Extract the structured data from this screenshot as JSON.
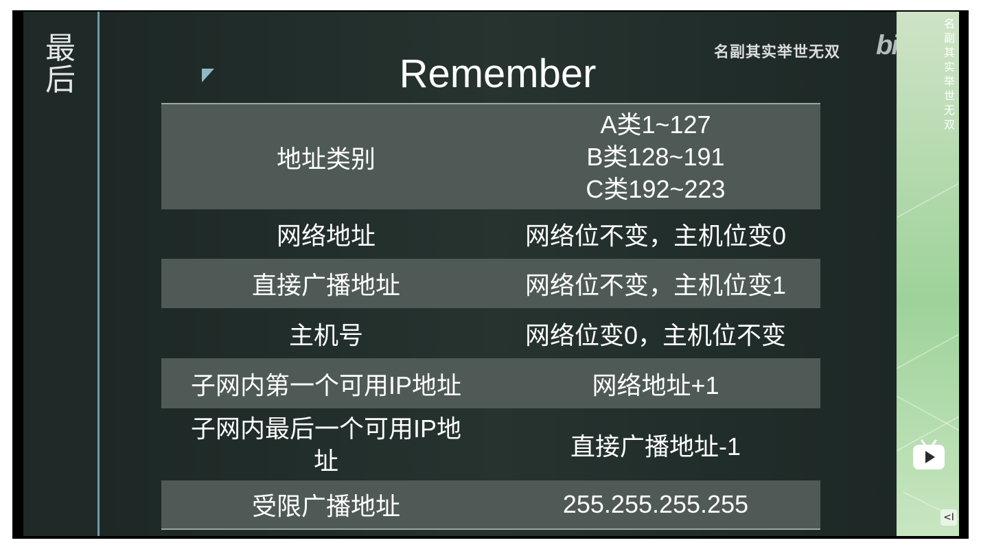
{
  "side_title": "最后",
  "heading": "Remember",
  "watermark": "名副其实举世无双",
  "logo": "bilibili",
  "side_vertical_text": "名副其实举世无双",
  "collapse_label": "<I",
  "rows": [
    {
      "label": "地址类别",
      "value_lines": [
        "A类1~127",
        "B类128~191",
        "C类192~223"
      ]
    },
    {
      "label": "网络地址",
      "value": "网络位不变，主机位变0"
    },
    {
      "label": "直接广播地址",
      "value": "网络位不变，主机位变1"
    },
    {
      "label": "主机号",
      "value": "网络位变0，主机位不变"
    },
    {
      "label": "子网内第一个可用IP地址",
      "value": "网络地址+1"
    },
    {
      "label_lines": [
        "子网内最后一个可用IP地",
        "址"
      ],
      "value": "直接广播地址-1"
    },
    {
      "label": "受限广播地址",
      "value": "255.255.255.255"
    }
  ],
  "colors": {
    "slide_bg": "#26332f",
    "row_shade": "#4f5a57",
    "accent": "#8fb8c4",
    "side_deco": "#9ed29a"
  },
  "icons": [
    "triangle-marker-icon",
    "bilibili-tv-icon"
  ]
}
